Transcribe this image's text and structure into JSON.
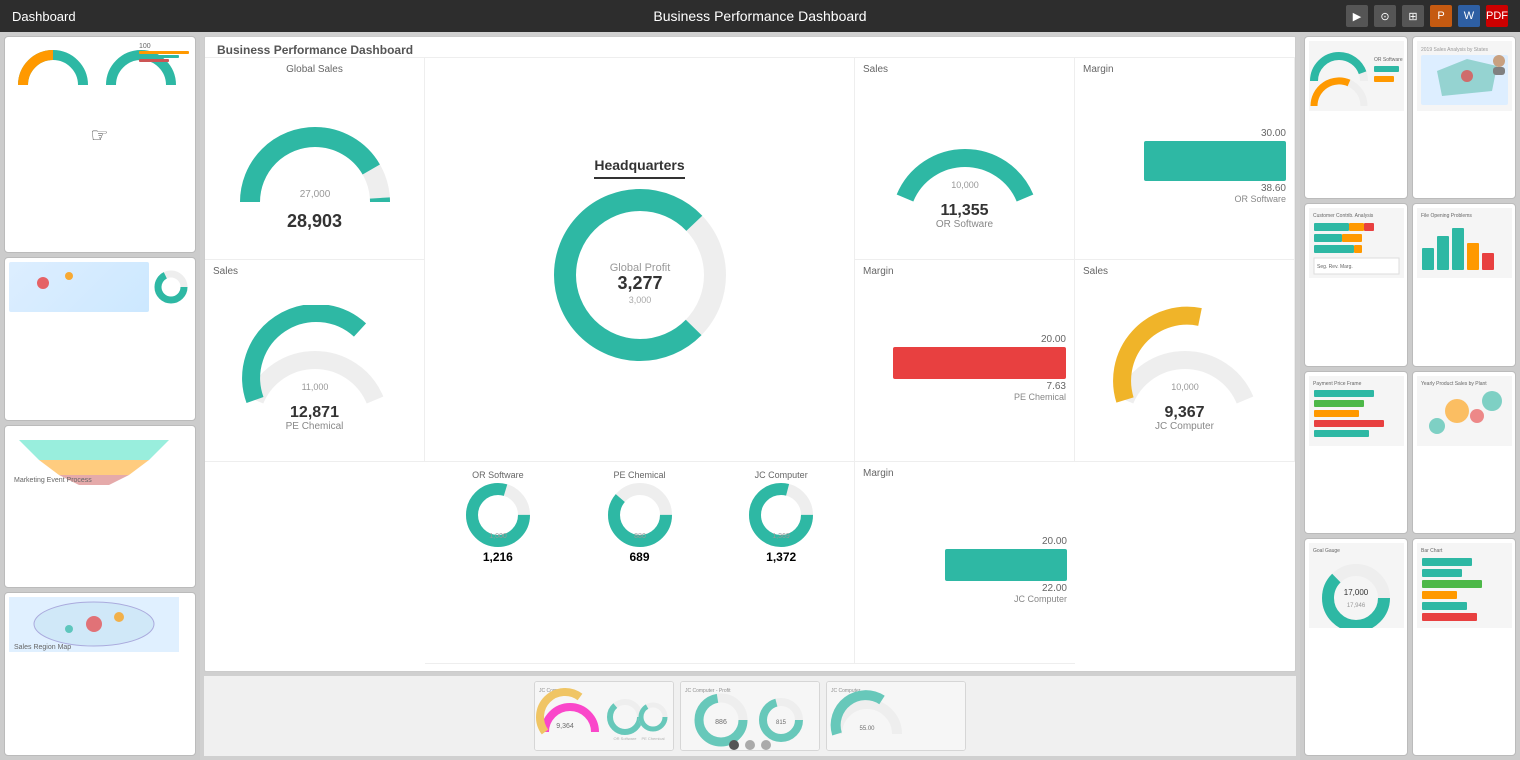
{
  "topbar": {
    "left_label": "Dashboard",
    "center_label": "Business Performance Dashboard",
    "icons": [
      {
        "name": "play-icon",
        "symbol": "▶",
        "class": ""
      },
      {
        "name": "info-icon",
        "symbol": "⊙",
        "class": ""
      },
      {
        "name": "grid-icon",
        "symbol": "⊞",
        "class": ""
      },
      {
        "name": "ppt-icon",
        "symbol": "P",
        "class": "ppt"
      },
      {
        "name": "word-icon",
        "symbol": "W",
        "class": "word"
      },
      {
        "name": "pdf-icon",
        "symbol": "PDF",
        "class": "pdf"
      }
    ]
  },
  "dashboard": {
    "title": "Business Performance Dashboard",
    "sections": {
      "row1": {
        "sales_label": "Sales",
        "sales_or_value": "11,355",
        "sales_or_target": "10,000",
        "sales_or_company": "OR Software",
        "global_sales_label": "Global Sales",
        "global_sales_value": "28,903",
        "global_sales_target": "27,000",
        "margin_label": "Margin",
        "margin_or_value": "38.60",
        "margin_or_target": "30.00",
        "margin_or_company": "OR Software"
      },
      "row2": {
        "sales_label": "Sales",
        "sales_pe_value": "12,871",
        "sales_pe_target": "11,000",
        "sales_pe_company": "PE Chemical",
        "hq_label": "Headquarters",
        "global_profit_label": "Global Profit",
        "global_profit_value": "3,277",
        "big_donut_value": "3,000",
        "margin_label": "Margin",
        "margin_pe_value": "7.63",
        "margin_pe_target": "20.00",
        "margin_pe_company": "PE Chemical",
        "margin_pe_negative": true
      },
      "row3": {
        "sales_label": "Sales",
        "sales_jc_value": "9,367",
        "sales_jc_target": "10,000",
        "sales_jc_company": "JC Computer",
        "or_small_label": "OR Software",
        "or_small_value": "1,216",
        "or_small_target": "1,000",
        "pe_small_label": "PE Chemical",
        "pe_small_value": "689",
        "pe_small_target": "880",
        "jc_small_label": "JC Computer",
        "jc_small_value": "1,372",
        "jc_small_target": "1,369",
        "margin_label": "Margin",
        "margin_jc_value": "22.00",
        "margin_jc_target": "20.00",
        "margin_jc_company": "JC Computer"
      }
    }
  },
  "slide_navigation": {
    "dots": [
      {
        "active": true
      },
      {
        "active": false
      },
      {
        "active": false
      }
    ]
  }
}
